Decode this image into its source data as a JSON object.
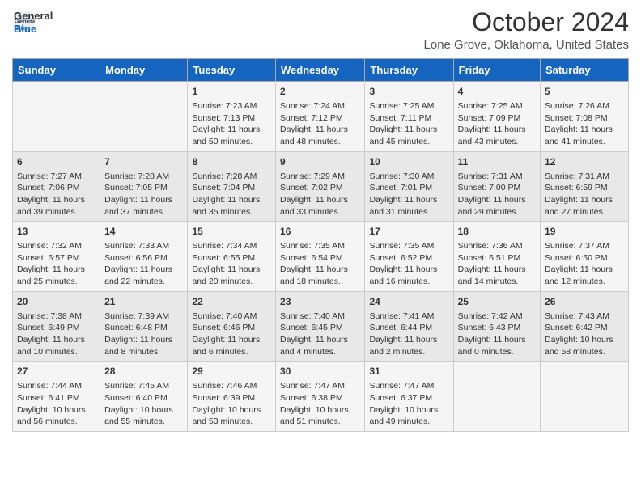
{
  "header": {
    "logo_line1": "General",
    "logo_line2": "Blue",
    "title": "October 2024",
    "subtitle": "Lone Grove, Oklahoma, United States"
  },
  "days_of_week": [
    "Sunday",
    "Monday",
    "Tuesday",
    "Wednesday",
    "Thursday",
    "Friday",
    "Saturday"
  ],
  "weeks": [
    [
      {
        "day": "",
        "sunrise": "",
        "sunset": "",
        "daylight": ""
      },
      {
        "day": "",
        "sunrise": "",
        "sunset": "",
        "daylight": ""
      },
      {
        "day": "1",
        "sunrise": "Sunrise: 7:23 AM",
        "sunset": "Sunset: 7:13 PM",
        "daylight": "Daylight: 11 hours and 50 minutes."
      },
      {
        "day": "2",
        "sunrise": "Sunrise: 7:24 AM",
        "sunset": "Sunset: 7:12 PM",
        "daylight": "Daylight: 11 hours and 48 minutes."
      },
      {
        "day": "3",
        "sunrise": "Sunrise: 7:25 AM",
        "sunset": "Sunset: 7:11 PM",
        "daylight": "Daylight: 11 hours and 45 minutes."
      },
      {
        "day": "4",
        "sunrise": "Sunrise: 7:25 AM",
        "sunset": "Sunset: 7:09 PM",
        "daylight": "Daylight: 11 hours and 43 minutes."
      },
      {
        "day": "5",
        "sunrise": "Sunrise: 7:26 AM",
        "sunset": "Sunset: 7:08 PM",
        "daylight": "Daylight: 11 hours and 41 minutes."
      }
    ],
    [
      {
        "day": "6",
        "sunrise": "Sunrise: 7:27 AM",
        "sunset": "Sunset: 7:06 PM",
        "daylight": "Daylight: 11 hours and 39 minutes."
      },
      {
        "day": "7",
        "sunrise": "Sunrise: 7:28 AM",
        "sunset": "Sunset: 7:05 PM",
        "daylight": "Daylight: 11 hours and 37 minutes."
      },
      {
        "day": "8",
        "sunrise": "Sunrise: 7:28 AM",
        "sunset": "Sunset: 7:04 PM",
        "daylight": "Daylight: 11 hours and 35 minutes."
      },
      {
        "day": "9",
        "sunrise": "Sunrise: 7:29 AM",
        "sunset": "Sunset: 7:02 PM",
        "daylight": "Daylight: 11 hours and 33 minutes."
      },
      {
        "day": "10",
        "sunrise": "Sunrise: 7:30 AM",
        "sunset": "Sunset: 7:01 PM",
        "daylight": "Daylight: 11 hours and 31 minutes."
      },
      {
        "day": "11",
        "sunrise": "Sunrise: 7:31 AM",
        "sunset": "Sunset: 7:00 PM",
        "daylight": "Daylight: 11 hours and 29 minutes."
      },
      {
        "day": "12",
        "sunrise": "Sunrise: 7:31 AM",
        "sunset": "Sunset: 6:59 PM",
        "daylight": "Daylight: 11 hours and 27 minutes."
      }
    ],
    [
      {
        "day": "13",
        "sunrise": "Sunrise: 7:32 AM",
        "sunset": "Sunset: 6:57 PM",
        "daylight": "Daylight: 11 hours and 25 minutes."
      },
      {
        "day": "14",
        "sunrise": "Sunrise: 7:33 AM",
        "sunset": "Sunset: 6:56 PM",
        "daylight": "Daylight: 11 hours and 22 minutes."
      },
      {
        "day": "15",
        "sunrise": "Sunrise: 7:34 AM",
        "sunset": "Sunset: 6:55 PM",
        "daylight": "Daylight: 11 hours and 20 minutes."
      },
      {
        "day": "16",
        "sunrise": "Sunrise: 7:35 AM",
        "sunset": "Sunset: 6:54 PM",
        "daylight": "Daylight: 11 hours and 18 minutes."
      },
      {
        "day": "17",
        "sunrise": "Sunrise: 7:35 AM",
        "sunset": "Sunset: 6:52 PM",
        "daylight": "Daylight: 11 hours and 16 minutes."
      },
      {
        "day": "18",
        "sunrise": "Sunrise: 7:36 AM",
        "sunset": "Sunset: 6:51 PM",
        "daylight": "Daylight: 11 hours and 14 minutes."
      },
      {
        "day": "19",
        "sunrise": "Sunrise: 7:37 AM",
        "sunset": "Sunset: 6:50 PM",
        "daylight": "Daylight: 11 hours and 12 minutes."
      }
    ],
    [
      {
        "day": "20",
        "sunrise": "Sunrise: 7:38 AM",
        "sunset": "Sunset: 6:49 PM",
        "daylight": "Daylight: 11 hours and 10 minutes."
      },
      {
        "day": "21",
        "sunrise": "Sunrise: 7:39 AM",
        "sunset": "Sunset: 6:48 PM",
        "daylight": "Daylight: 11 hours and 8 minutes."
      },
      {
        "day": "22",
        "sunrise": "Sunrise: 7:40 AM",
        "sunset": "Sunset: 6:46 PM",
        "daylight": "Daylight: 11 hours and 6 minutes."
      },
      {
        "day": "23",
        "sunrise": "Sunrise: 7:40 AM",
        "sunset": "Sunset: 6:45 PM",
        "daylight": "Daylight: 11 hours and 4 minutes."
      },
      {
        "day": "24",
        "sunrise": "Sunrise: 7:41 AM",
        "sunset": "Sunset: 6:44 PM",
        "daylight": "Daylight: 11 hours and 2 minutes."
      },
      {
        "day": "25",
        "sunrise": "Sunrise: 7:42 AM",
        "sunset": "Sunset: 6:43 PM",
        "daylight": "Daylight: 11 hours and 0 minutes."
      },
      {
        "day": "26",
        "sunrise": "Sunrise: 7:43 AM",
        "sunset": "Sunset: 6:42 PM",
        "daylight": "Daylight: 10 hours and 58 minutes."
      }
    ],
    [
      {
        "day": "27",
        "sunrise": "Sunrise: 7:44 AM",
        "sunset": "Sunset: 6:41 PM",
        "daylight": "Daylight: 10 hours and 56 minutes."
      },
      {
        "day": "28",
        "sunrise": "Sunrise: 7:45 AM",
        "sunset": "Sunset: 6:40 PM",
        "daylight": "Daylight: 10 hours and 55 minutes."
      },
      {
        "day": "29",
        "sunrise": "Sunrise: 7:46 AM",
        "sunset": "Sunset: 6:39 PM",
        "daylight": "Daylight: 10 hours and 53 minutes."
      },
      {
        "day": "30",
        "sunrise": "Sunrise: 7:47 AM",
        "sunset": "Sunset: 6:38 PM",
        "daylight": "Daylight: 10 hours and 51 minutes."
      },
      {
        "day": "31",
        "sunrise": "Sunrise: 7:47 AM",
        "sunset": "Sunset: 6:37 PM",
        "daylight": "Daylight: 10 hours and 49 minutes."
      },
      {
        "day": "",
        "sunrise": "",
        "sunset": "",
        "daylight": ""
      },
      {
        "day": "",
        "sunrise": "",
        "sunset": "",
        "daylight": ""
      }
    ]
  ]
}
